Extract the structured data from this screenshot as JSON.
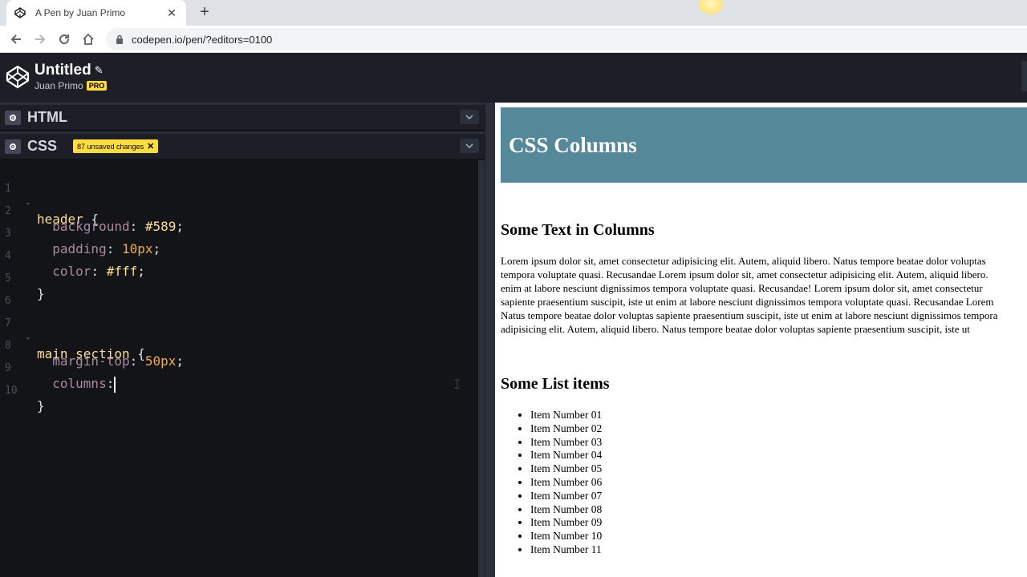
{
  "browser": {
    "tab_title": "A Pen by Juan Primo",
    "tab_close": "✕",
    "new_tab": "+",
    "url": "codepen.io/pen/?editors=0100"
  },
  "codepen": {
    "title": "Untitled",
    "author": "Juan Primo",
    "pro_badge": "PRO"
  },
  "editors": {
    "html_label": "HTML",
    "css_label": "CSS",
    "unsaved_text": "87 unsaved changes",
    "unsaved_close": "✕"
  },
  "code": {
    "line_numbers": [
      "1",
      "2",
      "3",
      "4",
      "5",
      "6",
      "7",
      "8",
      "9",
      "10"
    ],
    "l1_sel": "header",
    "l1_brace": " {",
    "l2_prop": "background",
    "l2_val": "#589",
    "l3_prop": "padding",
    "l3_val": "10px",
    "l4_prop": "color",
    "l4_val": "#fff",
    "l5": "}",
    "l7_sel": "main section",
    "l7_brace": " {",
    "l8_prop": "margin-top",
    "l8_val": "50px",
    "l9_prop": "columns",
    "l10": "}"
  },
  "preview": {
    "header_title": "CSS Columns",
    "section1_title": "Some Text in Columns",
    "paragraph_lines": [
      "Lorem ipsum dolor sit, amet consectetur adipisicing elit. Autem, aliquid libero. Natus tempore beatae dolor voluptas",
      "tempora voluptate quasi. Recusandae Lorem ipsum dolor sit, amet consectetur adipisicing elit. Autem, aliquid libero.",
      "enim at labore nesciunt dignissimos tempora voluptate quasi. Recusandae! Lorem ipsum dolor sit, amet consectetur",
      "sapiente praesentium suscipit, iste ut enim at labore nesciunt dignissimos tempora voluptate quasi. Recusandae Lorem",
      "Natus tempore beatae dolor voluptas sapiente praesentium suscipit, iste ut enim at labore nesciunt dignissimos tempora",
      "adipisicing elit. Autem, aliquid libero. Natus tempore beatae dolor voluptas sapiente praesentium suscipit, iste ut"
    ],
    "section2_title": "Some List items",
    "list_items": [
      "Item Number 01",
      "Item Number 02",
      "Item Number 03",
      "Item Number 04",
      "Item Number 05",
      "Item Number 06",
      "Item Number 07",
      "Item Number 08",
      "Item Number 09",
      "Item Number 10",
      "Item Number 11"
    ]
  },
  "colors": {
    "header_bg": "#558899",
    "editor_bg": "#131417",
    "badge_yellow": "#ffdd40"
  }
}
